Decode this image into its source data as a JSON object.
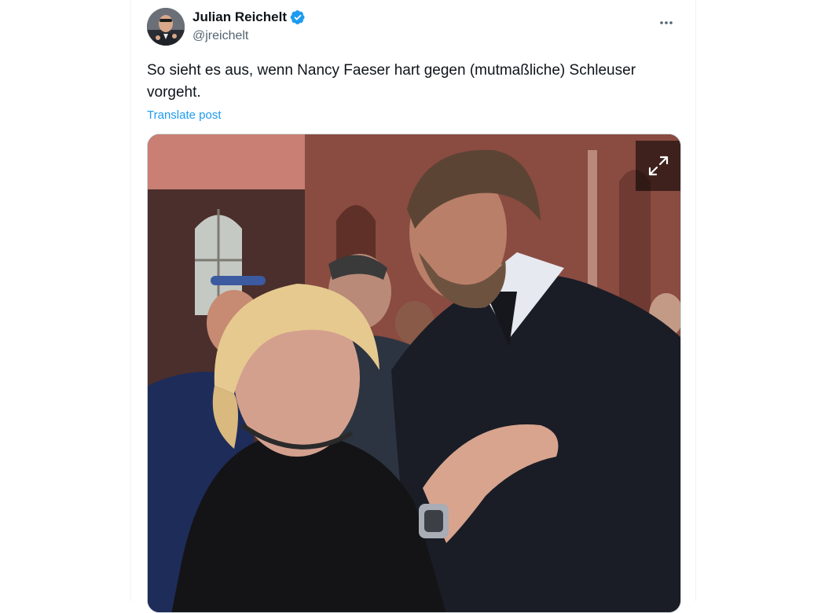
{
  "post": {
    "author": {
      "display_name": "Julian Reichelt",
      "handle": "@jreichelt",
      "verified": true,
      "verified_color": "#1d9bf0"
    },
    "text": "So sieht es aus, wenn Nancy Faeser hart gegen (mutmaßliche) Schleuser vorgeht.",
    "translate_label": "Translate post",
    "more_icon": "more-horizontal-icon",
    "media": {
      "type": "photo",
      "expand_icon": "expand-icon"
    }
  },
  "colors": {
    "link": "#1d9bf0",
    "text": "#0f1419",
    "secondary": "#536471",
    "border": "#cfd9de"
  }
}
